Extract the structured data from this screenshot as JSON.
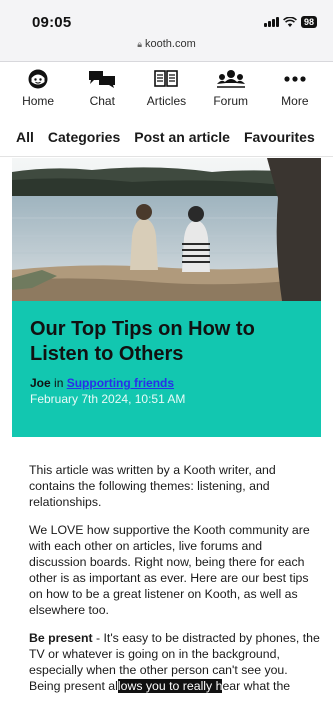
{
  "status_bar": {
    "time": "09:05",
    "battery": "98",
    "url": "kooth.com"
  },
  "nav": {
    "items": [
      {
        "label": "Home",
        "icon": "home-avatar-icon"
      },
      {
        "label": "Chat",
        "icon": "chat-bubbles-icon"
      },
      {
        "label": "Articles",
        "icon": "articles-icon"
      },
      {
        "label": "Forum",
        "icon": "forum-people-icon"
      },
      {
        "label": "More",
        "icon": "more-dots-icon"
      }
    ]
  },
  "subnav": {
    "items": [
      "All",
      "Categories",
      "Post an article",
      "Favourites"
    ]
  },
  "article": {
    "title": "Our Top Tips on How to Listen to Others",
    "author": "Joe",
    "in_text": "in",
    "category": "Supporting friends",
    "date": "February 7th 2024, 10:51 AM",
    "accent_color": "#12c7b0",
    "paragraphs": [
      "This article was written by a Kooth writer, and contains the following themes: listening, and relationships.",
      "We LOVE how supportive the Kooth community are with each other on articles, live forums and discussion boards. Right now, being there for each other is as important as ever. Here are our best tips on how to be a great listener on Kooth, as well as elsewhere too."
    ],
    "tip_heading": "Be present",
    "tip_text": " - It's easy to be distracted by phones, the TV or whatever is going on in the background, especially when the other person can't see you.",
    "cutoff_start": "Being present al",
    "cutoff_highlight": "lows you to really h",
    "cutoff_end": "ear what the"
  }
}
